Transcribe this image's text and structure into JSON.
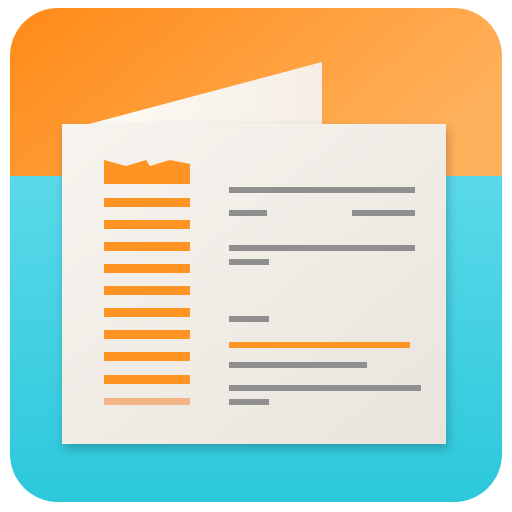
{
  "icon": {
    "name": "document-viewer-app-icon",
    "colors": {
      "top_band": "#ff9a1f",
      "top_band_light": "#ffb25c",
      "bottom_band": "#3cd6e6",
      "bottom_band_dark": "#2ec6d9",
      "paper": "#f1ede7",
      "paper_back": "#fbf8f3",
      "accent_orange": "#ff9424",
      "text_gray": "#8f8f8f"
    }
  }
}
